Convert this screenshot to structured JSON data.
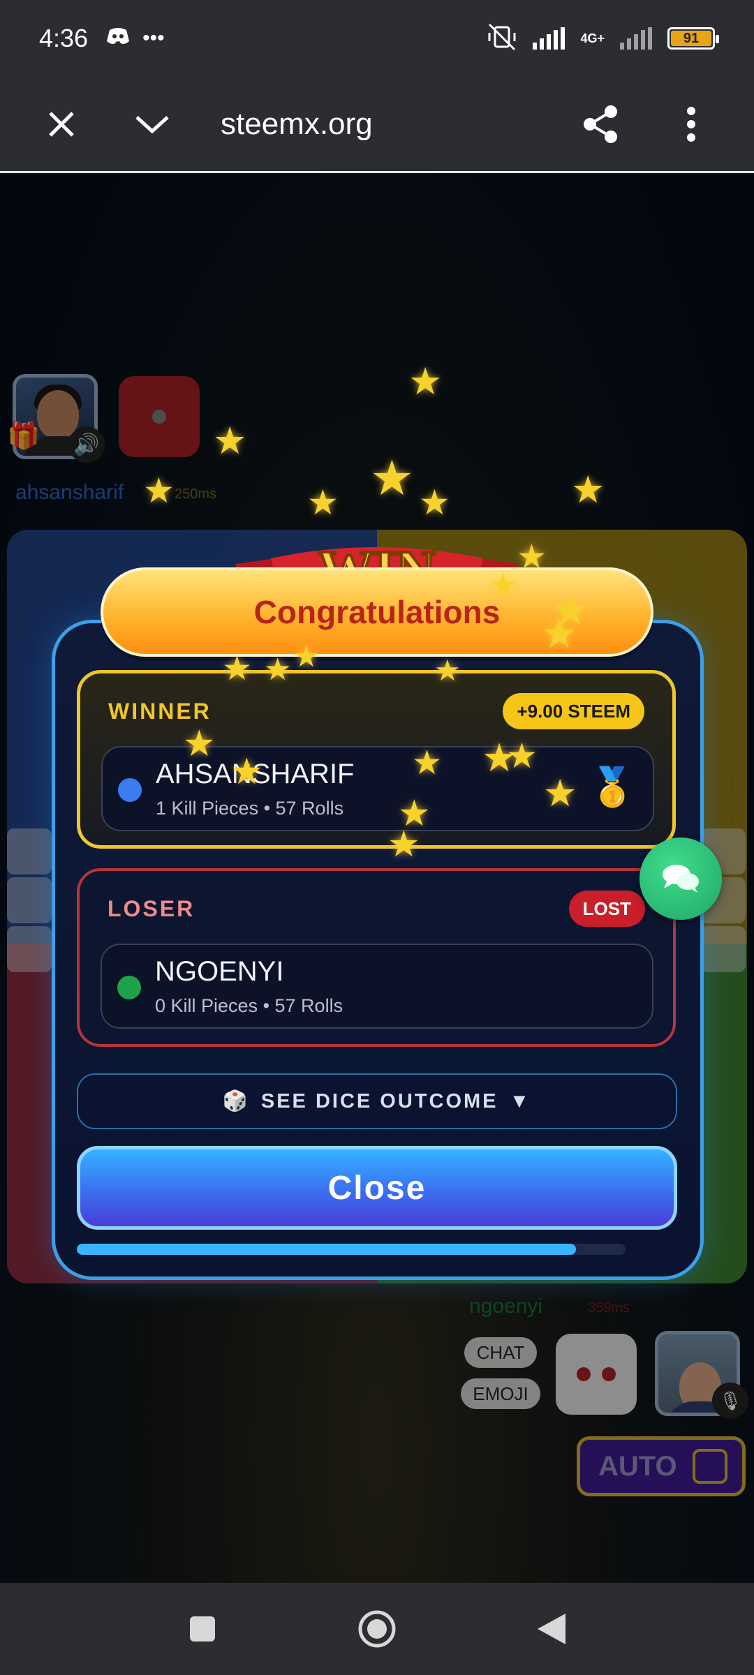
{
  "status_bar": {
    "time": "4:36",
    "battery": "91",
    "network": "4G+",
    "icons": [
      "discord-icon",
      "more-icon",
      "vibrate-off-icon",
      "signal-icon",
      "battery-icon"
    ]
  },
  "browser": {
    "url": "steemx.org",
    "icons": [
      "close-icon",
      "chevron-down-icon",
      "share-icon",
      "more-vert-icon"
    ]
  },
  "game": {
    "top_player": {
      "name": "ahsansharif",
      "ping": "250ms"
    },
    "bottom_player": {
      "name": "ngoenyi",
      "ping": "359ms"
    },
    "chat_label": "CHAT",
    "emoji_label": "EMOJI",
    "auto_label": "AUTO",
    "colors": {
      "blue": "#274ea0",
      "yellow": "#b49614",
      "red": "#a02323",
      "green": "#1e7837"
    }
  },
  "modal": {
    "banner": "WIN",
    "title": "Congratulations",
    "winner": {
      "label": "WINNER",
      "badge": "+9.00 STEEM",
      "name": "AHSANSHARIF",
      "stats": "1 Kill Pieces • 57 Rolls",
      "color": "#3b7cf0",
      "medal": "🥇"
    },
    "loser": {
      "label": "LOSER",
      "badge": "LOST",
      "name": "NGOENYI",
      "stats": "0 Kill Pieces • 57 Rolls",
      "color": "#1fa34a"
    },
    "dice_outcome_label": "SEE DICE OUTCOME",
    "dice_outcome_icon": "🎲",
    "close_label": "Close",
    "progress": 0.91
  }
}
